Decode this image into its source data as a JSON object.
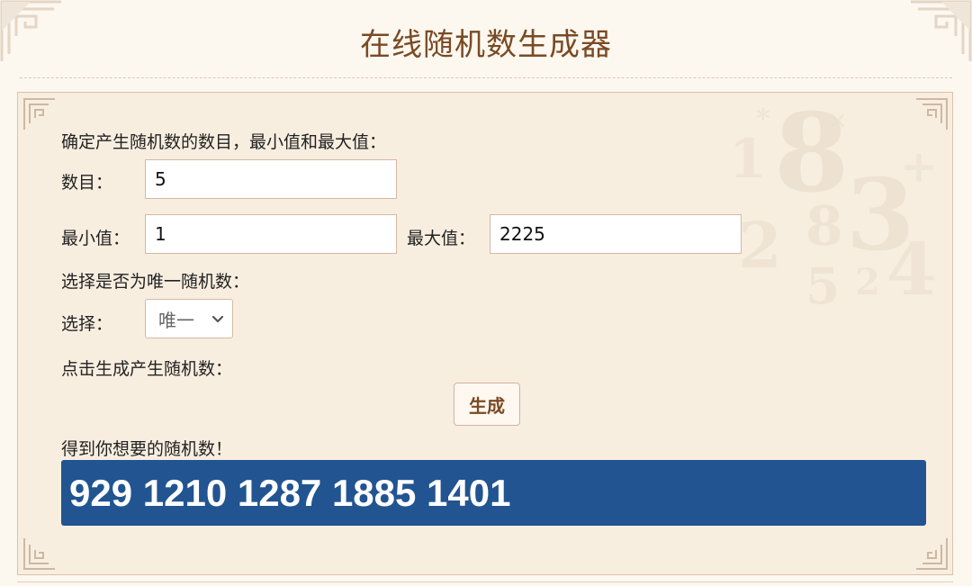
{
  "page": {
    "title": "在线随机数生成器"
  },
  "form": {
    "intro_label": "确定产生随机数的数目，最小值和最大值：",
    "count_label": "数目：",
    "count_value": "5",
    "min_label": "最小值：",
    "min_value": "1",
    "max_label": "最大值：",
    "max_value": "2225",
    "unique_prompt": "选择是否为唯一随机数：",
    "select_label": "选择：",
    "select_value": "唯一",
    "generate_prompt": "点击生成产生随机数：",
    "generate_button": "生成",
    "result_label": "得到你想要的随机数！",
    "result_value": "929 1210 1287 1885 1401"
  },
  "icons": {
    "select_arrow": "chevron-down-icon",
    "corner_ornament": "corner-ornament-icon",
    "background_art": "number-collage-background"
  },
  "colors": {
    "title": "#7a4a24",
    "panel_background": "#f8eee0",
    "result_background": "#215491",
    "result_text": "#ffffff",
    "button_text": "#7a4a24"
  }
}
